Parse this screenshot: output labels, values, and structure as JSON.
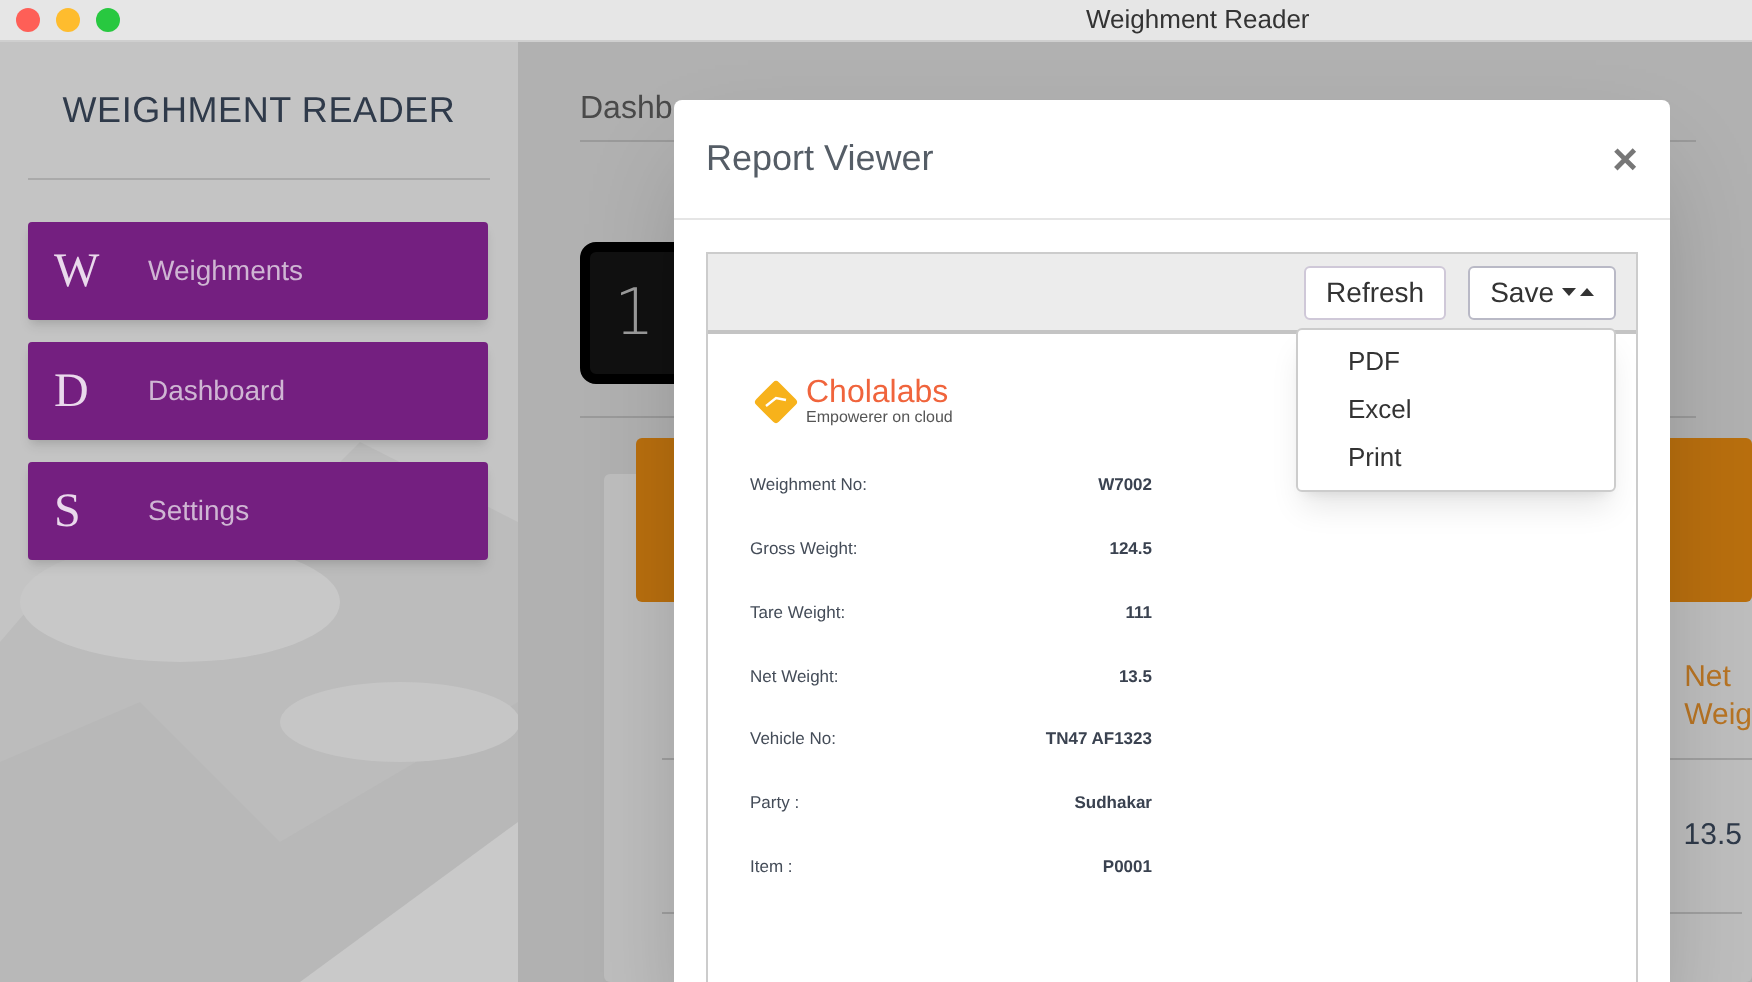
{
  "window": {
    "title": "Weighment Reader"
  },
  "sidebar": {
    "title": "WEIGHMENT READER",
    "items": [
      {
        "letter": "W",
        "label": "Weighments"
      },
      {
        "letter": "D",
        "label": "Dashboard"
      },
      {
        "letter": "S",
        "label": "Settings"
      }
    ]
  },
  "main": {
    "heading": "Dashb",
    "counter": "1",
    "table": {
      "columns": [
        {
          "lines": [
            "Net",
            "Weig"
          ]
        }
      ],
      "rows": [
        [
          "13.5"
        ]
      ]
    }
  },
  "modal": {
    "title": "Report Viewer",
    "close": "×",
    "toolbar": {
      "refresh": "Refresh",
      "save": "Save"
    },
    "menu": [
      {
        "label": "PDF"
      },
      {
        "label": "Excel"
      },
      {
        "label": "Print"
      }
    ],
    "logo": {
      "name": "Cholalabs",
      "tagline": "Empowerer on cloud"
    },
    "fields": [
      {
        "label": "Weighment No:",
        "value": "W7002"
      },
      {
        "label": "Gross Weight:",
        "value": "124.5"
      },
      {
        "label": "Tare Weight:",
        "value": "111"
      },
      {
        "label": "Net Weight:",
        "value": "13.5"
      },
      {
        "label": "Vehicle No:",
        "value": "TN47 AF1323"
      },
      {
        "label": "Party :",
        "value": "Sudhakar"
      },
      {
        "label": "Item :",
        "value": "P0001"
      }
    ]
  }
}
